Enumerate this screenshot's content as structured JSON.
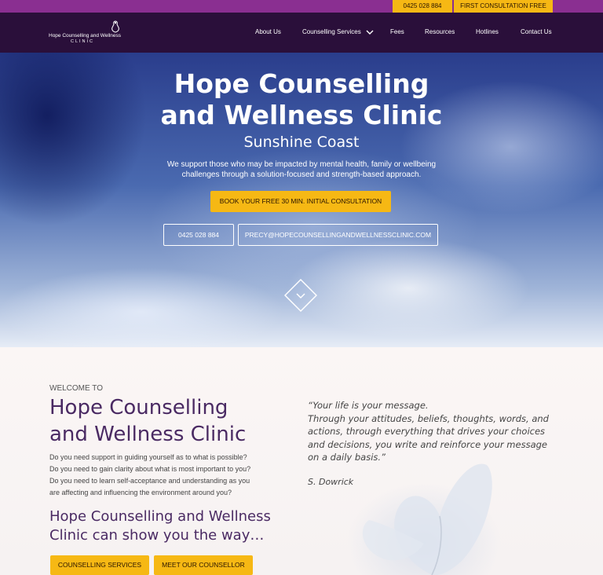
{
  "topbar": {
    "phone": "0425 028 884",
    "consultation": "FIRST CONSULTATION FREE"
  },
  "nav": {
    "logo_line1": "Hope Counselling and Wellness",
    "logo_line2": "CLINIC",
    "items": [
      "About Us",
      "Counselling Services",
      "Fees",
      "Resources",
      "Hotlines",
      "Contact Us"
    ]
  },
  "hero": {
    "title_line1": "Hope Counselling",
    "title_line2": "and Wellness Clinic",
    "subtitle": "Sunshine Coast",
    "description_line1": "We support those who may be impacted by mental health, family or wellbeing",
    "description_line2": "challenges through a solution-focused and strength-based approach.",
    "cta": "BOOK YOUR FREE 30 MIN. INITIAL CONSULTATION",
    "phone": "0425 028 884",
    "email": "PRECY@HOPECOUNSELLINGANDWELLNESSCLINIC.COM"
  },
  "welcome": {
    "kicker": "WELCOME TO",
    "title_line1": "Hope Counselling",
    "title_line2": "and Wellness Clinic",
    "body": [
      "Do you need support in guiding yourself as to what is possible?",
      "Do you need to gain clarity about what is most important to you?",
      "Do you need to learn self-acceptance and understanding as you",
      "are affecting and influencing the environment around you?"
    ],
    "tagline_line1": "Hope Counselling and Wellness",
    "tagline_line2": "Clinic can show you the way…",
    "btn_services": "COUNSELLING SERVICES",
    "btn_counsellor": "MEET OUR COUNSELLOR"
  },
  "quote": {
    "lines": [
      "“Your life is your message.",
      "Through your attitudes, beliefs, thoughts, words, and",
      "actions, through everything that drives your choices",
      "and decisions, you write and reinforce your message",
      "on a daily basis.”"
    ],
    "author": "S. Dowrick"
  },
  "colors": {
    "accent": "#f6b814",
    "topbar": "#8a2f91",
    "nav": "#2a0f3a",
    "heading": "#4a2a63"
  }
}
